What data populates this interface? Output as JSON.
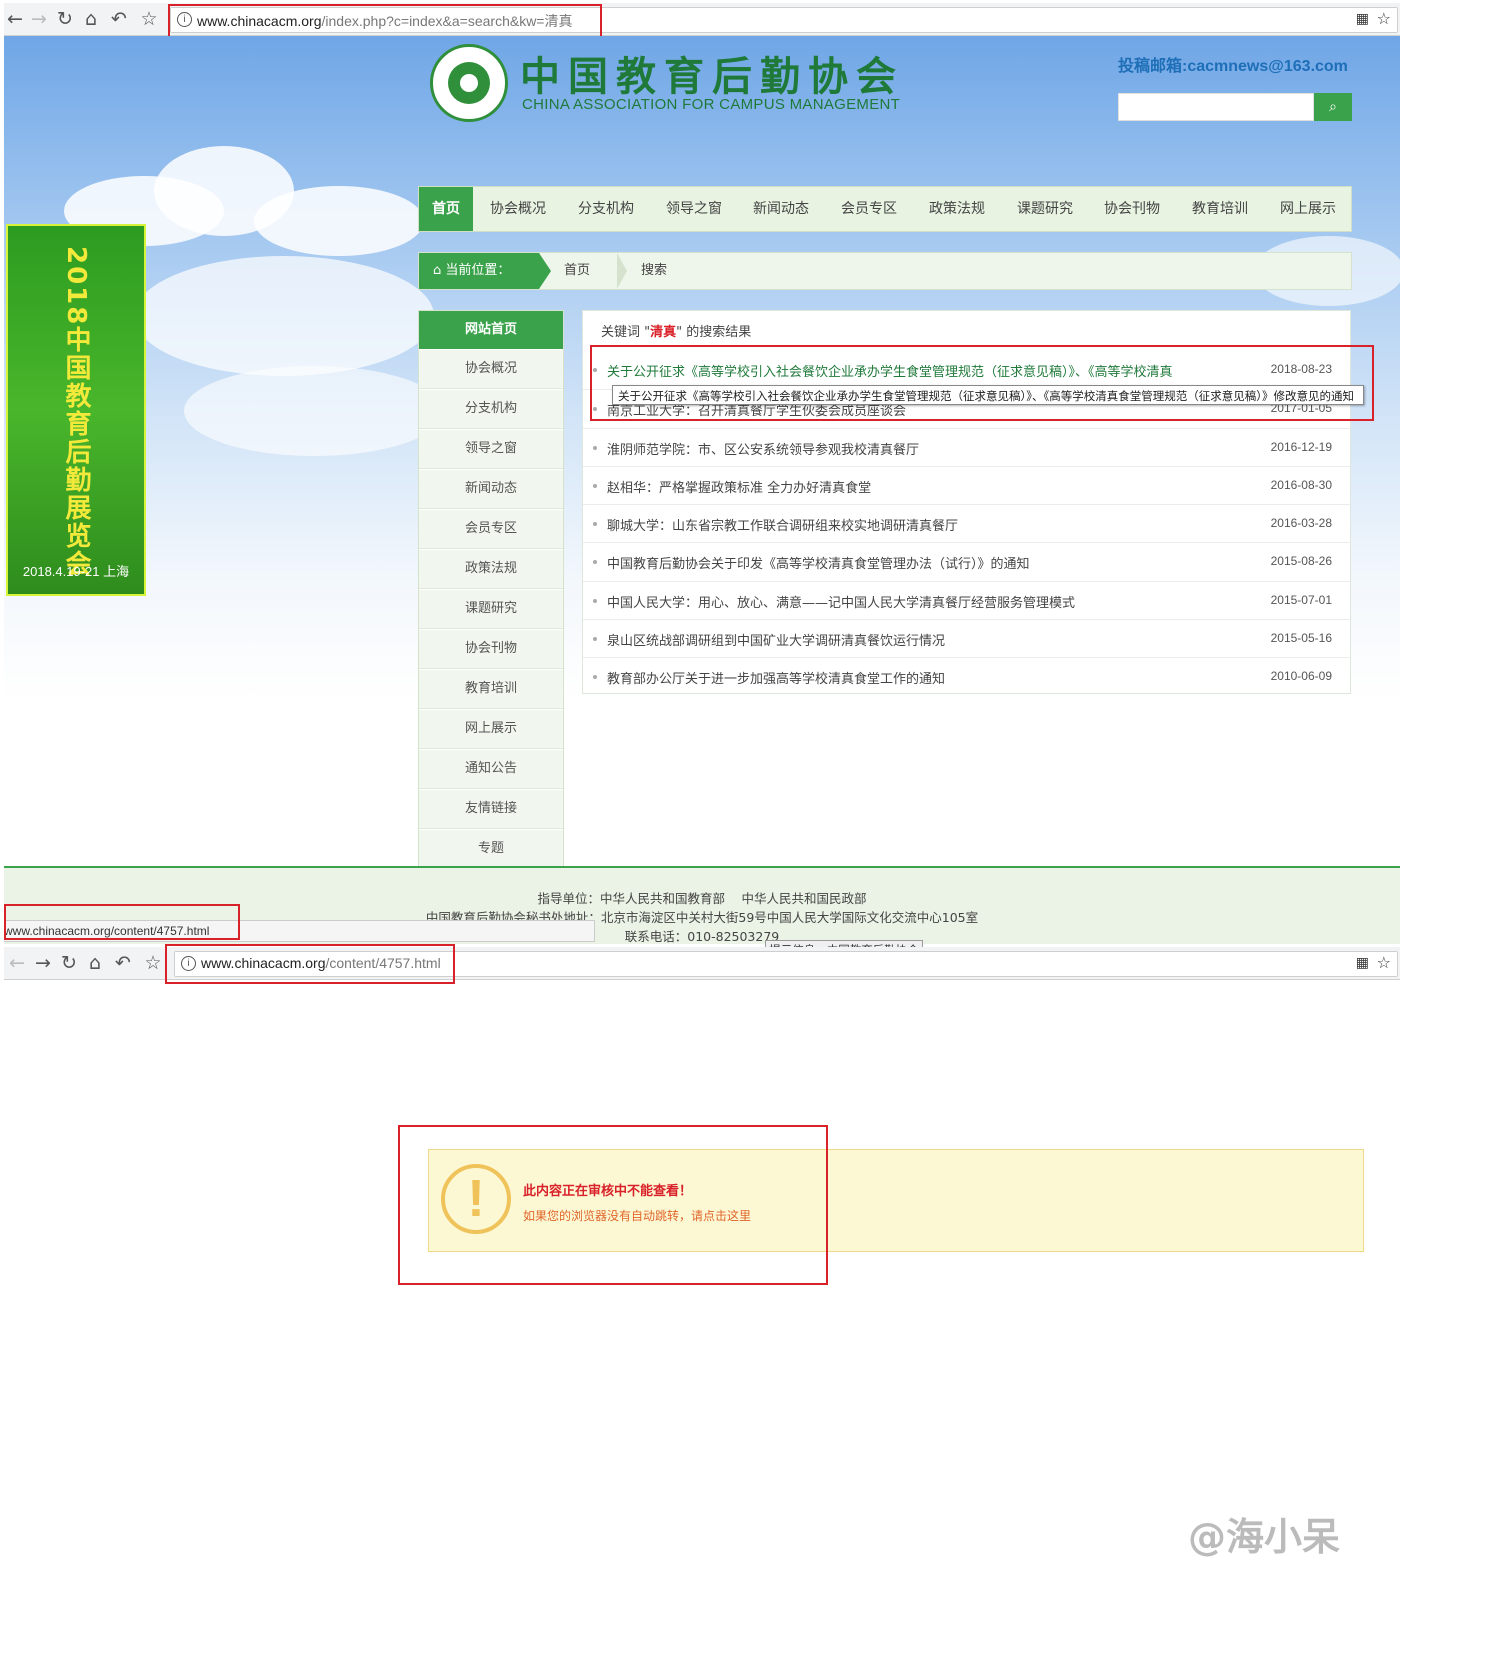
{
  "browser1": {
    "url_host": "www.chinacacm.org",
    "url_path": "/index.php?c=index&a=search&kw=清真"
  },
  "banner": {
    "title": "2018中国教育后勤展览会",
    "date": "2018.4.19-21 上海"
  },
  "header": {
    "cn_title": "中国教育后勤协会",
    "en_title": "CHINA ASSOCIATION FOR CAMPUS MANAGEMENT",
    "email": "投稿邮箱:cacmnews@163.com"
  },
  "nav": {
    "items": [
      "首页",
      "协会概况",
      "分支机构",
      "领导之窗",
      "新闻动态",
      "会员专区",
      "政策法规",
      "课题研究",
      "协会刊物",
      "教育培训",
      "网上展示"
    ]
  },
  "breadcrumb": {
    "label": "当前位置：",
    "items": [
      "首页",
      "搜索"
    ]
  },
  "sidebar": {
    "header": "网站首页",
    "items": [
      "协会概况",
      "分支机构",
      "领导之窗",
      "新闻动态",
      "会员专区",
      "政策法规",
      "课题研究",
      "协会刊物",
      "教育培训",
      "网上展示",
      "通知公告",
      "友情链接",
      "专题"
    ]
  },
  "results": {
    "keyword_prefix": "关键词 \"",
    "keyword": "清真",
    "keyword_suffix": "\" 的搜索结果",
    "rows": [
      {
        "title": "关于公开征求《高等学校引入社会餐饮企业承办学生食堂管理规范（征求意见稿）》、《高等学校清真",
        "date": "2018-08-23"
      },
      {
        "title": "南京工业大学：召开清真餐厅学生伙委会成员座谈会",
        "date": "2017-01-05"
      },
      {
        "title": "淮阴师范学院：市、区公安系统领导参观我校清真餐厅",
        "date": "2016-12-19"
      },
      {
        "title": "赵相华：严格掌握政策标准 全力办好清真食堂",
        "date": "2016-08-30"
      },
      {
        "title": "聊城大学：山东省宗教工作联合调研组来校实地调研清真餐厅",
        "date": "2016-03-28"
      },
      {
        "title": "中国教育后勤协会关于印发《高等学校清真食堂管理办法（试行）》的通知",
        "date": "2015-08-26"
      },
      {
        "title": "中国人民大学：用心、放心、满意——记中国人民大学清真餐厅经营服务管理模式",
        "date": "2015-07-01"
      },
      {
        "title": "泉山区统战部调研组到中国矿业大学调研清真餐饮运行情况",
        "date": "2015-05-16"
      },
      {
        "title": "教育部办公厅关于进一步加强高等学校清真食堂工作的通知",
        "date": "2010-06-09"
      }
    ],
    "tooltip": "关于公开征求《高等学校引入社会餐饮企业承办学生食堂管理规范（征求意见稿）》、《高等学校清真食堂管理规范（征求意见稿）》修改意见的通知"
  },
  "footer": {
    "line1": "指导单位：中华人民共和国教育部　 中华人民共和国民政部",
    "line2": "中国教育后勤协会秘书处地址：北京市海淀区中关村大街59号中国人民大学国际文化交流中心105室",
    "line3": "联系电话：010-82503279"
  },
  "statusbar": "www.chinacacm.org/content/4757.html",
  "tab_tip": "提示信息 - 中国教育后勤协会",
  "browser2": {
    "url_host": "www.chinacacm.org",
    "url_path": "/content/4757.html"
  },
  "notice": {
    "title": "此内容正在审核中不能查看！",
    "message": "如果您的浏览器没有自动跳转，请点击这里"
  },
  "watermark": "@海小呆"
}
